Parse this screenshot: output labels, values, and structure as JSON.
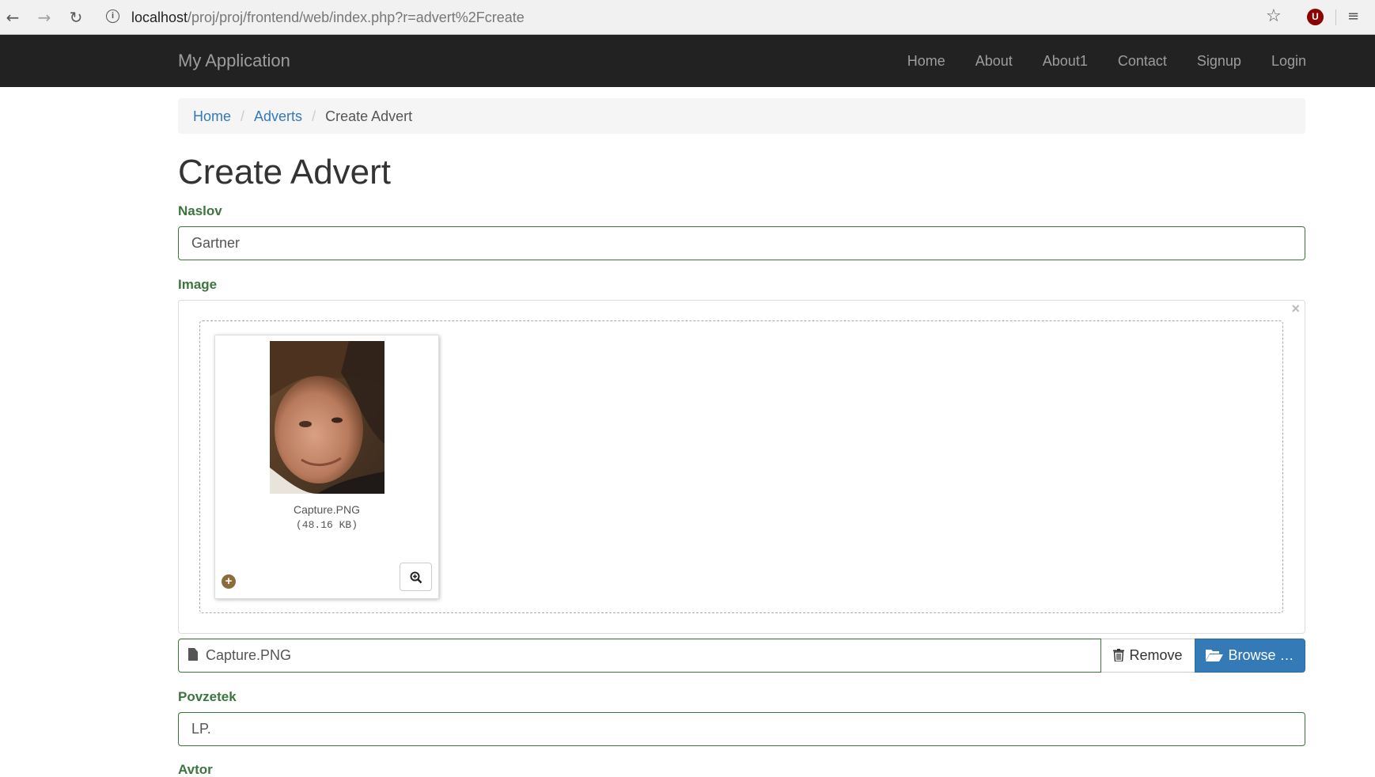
{
  "browser": {
    "url_host": "localhost",
    "url_path": "/proj/proj/frontend/web/index.php?r=advert%2Fcreate",
    "extension_letter": "U"
  },
  "navbar": {
    "brand": "My Application",
    "links": [
      "Home",
      "About",
      "About1",
      "Contact",
      "Signup",
      "Login"
    ]
  },
  "breadcrumb": {
    "items": [
      "Home",
      "Adverts"
    ],
    "active": "Create Advert"
  },
  "page": {
    "title": "Create Advert"
  },
  "form": {
    "naslov_label": "Naslov",
    "naslov_value": "Gartner",
    "image_label": "Image",
    "preview": {
      "file_name": "Capture.PNG",
      "file_size": "(48.16 KB)"
    },
    "caption_value": "Capture.PNG",
    "remove_label": "Remove",
    "browse_label": "Browse …",
    "povzetek_label": "Povzetek",
    "povzetek_value": "LP.",
    "avtor_label": "Avtor"
  },
  "colors": {
    "navbar_bg": "#222222",
    "success_green": "#3c763d",
    "primary_blue": "#337ab7"
  }
}
